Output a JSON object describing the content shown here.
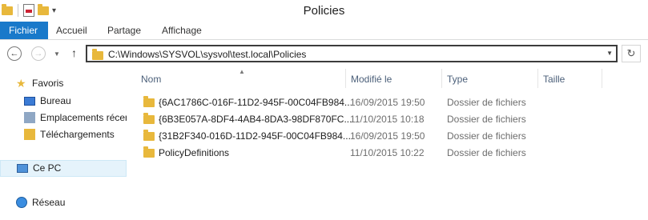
{
  "window": {
    "title": "Policies"
  },
  "ribbon": {
    "tabs": [
      {
        "label": "Fichier",
        "active": true
      },
      {
        "label": "Accueil",
        "active": false
      },
      {
        "label": "Partage",
        "active": false
      },
      {
        "label": "Affichage",
        "active": false
      }
    ]
  },
  "address": {
    "path": "C:\\Windows\\SYSVOL\\sysvol\\test.local\\Policies"
  },
  "sidebar": {
    "items": [
      {
        "label": "Favoris",
        "icon": "star-icon"
      },
      {
        "label": "Bureau",
        "icon": "desktop-icon"
      },
      {
        "label": "Emplacements récents",
        "icon": "recent-places-icon"
      },
      {
        "label": "Téléchargements",
        "icon": "downloads-icon"
      },
      {
        "label": "Ce PC",
        "icon": "computer-icon"
      },
      {
        "label": "Réseau",
        "icon": "network-icon"
      }
    ]
  },
  "columns": {
    "name": "Nom",
    "modified": "Modifié le",
    "type": "Type",
    "size": "Taille"
  },
  "files": [
    {
      "name": "{6AC1786C-016F-11D2-945F-00C04FB984...",
      "modified": "16/09/2015 19:50",
      "type": "Dossier de fichiers",
      "size": ""
    },
    {
      "name": "{6B3E057A-8DF4-4AB4-8DA3-98DF870FC...",
      "modified": "11/10/2015 10:18",
      "type": "Dossier de fichiers",
      "size": ""
    },
    {
      "name": "{31B2F340-016D-11D2-945F-00C04FB984...",
      "modified": "16/09/2015 19:50",
      "type": "Dossier de fichiers",
      "size": ""
    },
    {
      "name": "PolicyDefinitions",
      "modified": "11/10/2015 10:22",
      "type": "Dossier de fichiers",
      "size": ""
    }
  ],
  "colors": {
    "accent": "#1979ca",
    "folder": "#e8b83c",
    "header_text": "#4c607a"
  }
}
